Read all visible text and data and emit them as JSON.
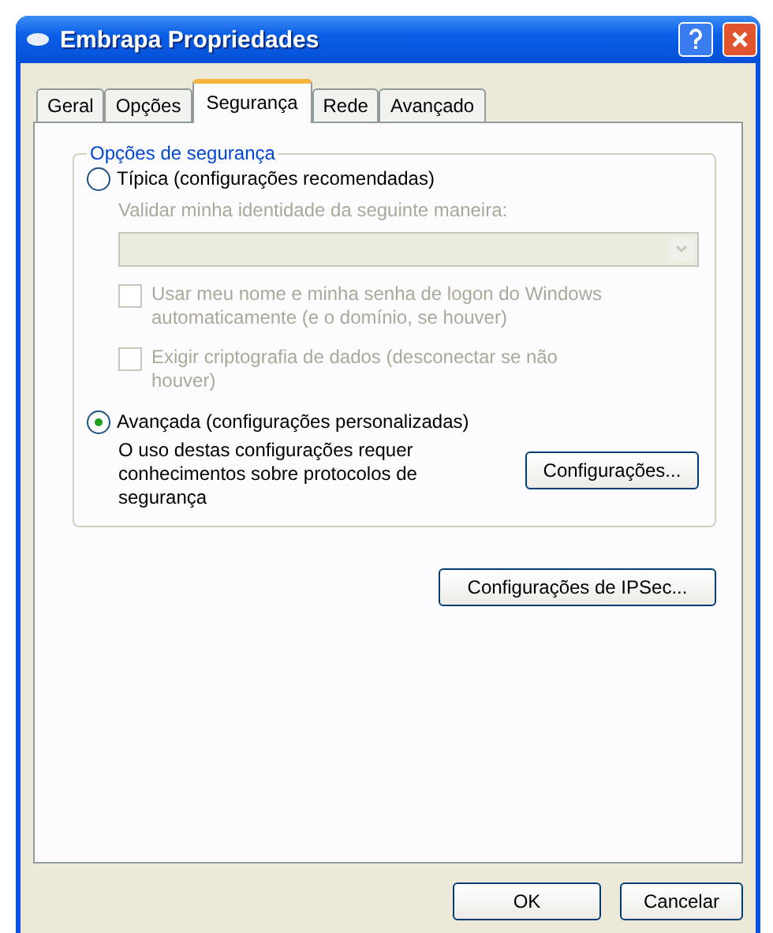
{
  "window": {
    "title": "Embrapa Propriedades"
  },
  "tabs": [
    {
      "label": "Geral",
      "selected": false
    },
    {
      "label": "Opções",
      "selected": false
    },
    {
      "label": "Segurança",
      "selected": true
    },
    {
      "label": "Rede",
      "selected": false
    },
    {
      "label": "Avançado",
      "selected": false
    }
  ],
  "security_options": {
    "title": "Opções de segurança",
    "typical": {
      "label": "Típica (configurações recomendadas)",
      "selected": false,
      "validate_label": "Validar minha identidade da seguinte maneira:",
      "disabled": true,
      "checkboxes": [
        {
          "label": "Usar meu nome e minha senha de logon do Windows automaticamente (e o domínio, se houver)",
          "checked": false,
          "disabled": true
        },
        {
          "label": "Exigir criptografia de dados (desconectar se não houver)",
          "checked": false,
          "disabled": true
        }
      ]
    },
    "advanced": {
      "label": "Avançada (configurações personalizadas)",
      "selected": true,
      "description": "O uso destas configurações requer conhecimentos sobre protocolos de segurança",
      "button": "Configurações..."
    }
  },
  "ipsec_button": "Configurações de IPSec...",
  "buttons": [
    "OK",
    "Cancelar"
  ]
}
